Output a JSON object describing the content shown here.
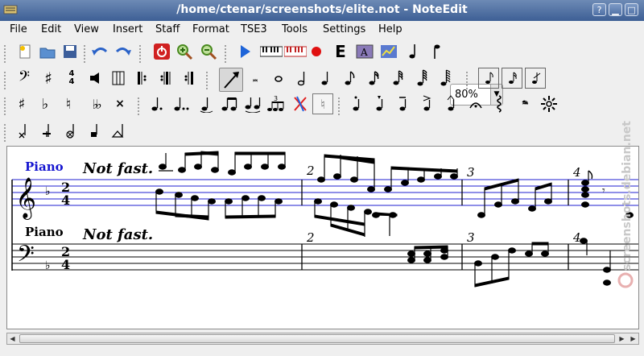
{
  "window": {
    "title": "/home/ctenar/screenshots/elite.not - NoteEdit"
  },
  "menu": [
    "File",
    "Edit",
    "View",
    "Insert",
    "Staff",
    "Format",
    "TSE3",
    "Tools",
    "Settings",
    "Help"
  ],
  "toolbar": {
    "zoom_value": "80%"
  },
  "score": {
    "staff1": {
      "name": "Piano",
      "tempo": "Not fast.",
      "time_top": "2",
      "time_bottom": "4",
      "measures": [
        "2",
        "3",
        "4"
      ]
    },
    "staff2": {
      "name": "Piano",
      "tempo": "Not fast.",
      "time_top": "2",
      "time_bottom": "4",
      "measures": [
        "2",
        "3",
        "4"
      ]
    }
  },
  "watermark": "screenshots.debian.net",
  "colors": {
    "titlebar": "#4a6aa0",
    "staff_line_blue": "#1f1fd1",
    "staff_name_blue": "#1515d0"
  }
}
